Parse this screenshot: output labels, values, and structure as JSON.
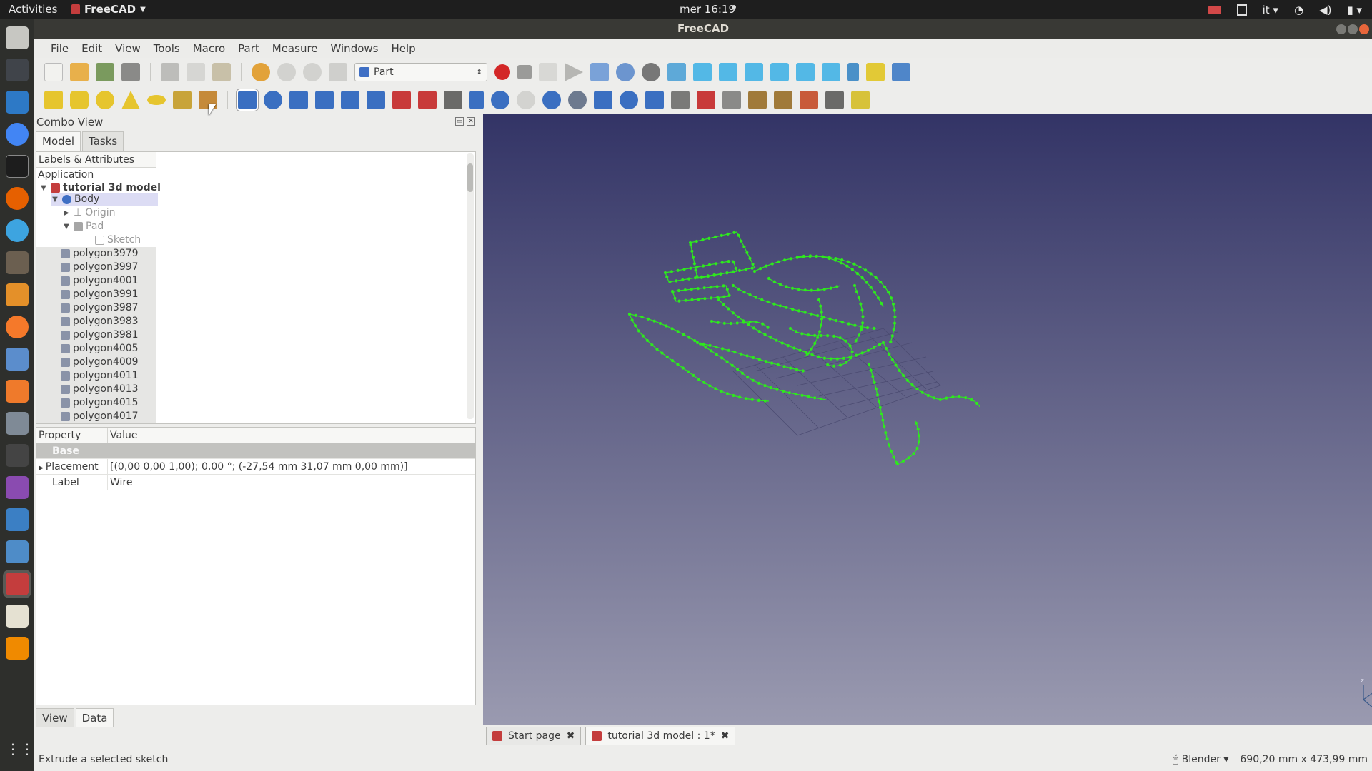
{
  "topbar": {
    "activities": "Activities",
    "app_name": "FreeCAD",
    "clock": "mer 16:19",
    "keyboard_layout": "it"
  },
  "window": {
    "title": "FreeCAD"
  },
  "menubar": {
    "items": [
      "File",
      "Edit",
      "View",
      "Tools",
      "Macro",
      "Part",
      "Measure",
      "Windows",
      "Help"
    ]
  },
  "toolbar": {
    "workbench_selected": "Part"
  },
  "combo": {
    "title": "Combo View",
    "tabs": [
      "Model",
      "Tasks"
    ],
    "tree_header": "Labels & Attributes",
    "tree": {
      "application": "Application",
      "document": "tutorial 3d model",
      "body": "Body",
      "origin": "Origin",
      "pad": "Pad",
      "sketch": "Sketch",
      "polygons": [
        "polygon3979",
        "polygon3997",
        "polygon4001",
        "polygon3991",
        "polygon3987",
        "polygon3983",
        "polygon3981",
        "polygon4005",
        "polygon4009",
        "polygon4011",
        "polygon4013",
        "polygon4015",
        "polygon4017"
      ]
    },
    "property_header": {
      "property": "Property",
      "value": "Value"
    },
    "properties": {
      "group": "Base",
      "placement_label": "Placement",
      "placement_value": "[(0,00 0,00 1,00); 0,00 °; (-27,54 mm  31,07 mm  0,00 mm)]",
      "label_label": "Label",
      "label_value": "Wire"
    },
    "bottom_tabs": [
      "View",
      "Data"
    ]
  },
  "doc_tabs": [
    "Start page",
    "tutorial 3d model : 1*"
  ],
  "status": {
    "message": "Extrude a selected sketch",
    "navigation": "Blender",
    "dimensions": "690,20 mm x 473,99 mm"
  },
  "colors": {
    "wire": "#2ee81e",
    "viewport_top": "#333466",
    "viewport_bottom": "#9a9ab0"
  }
}
